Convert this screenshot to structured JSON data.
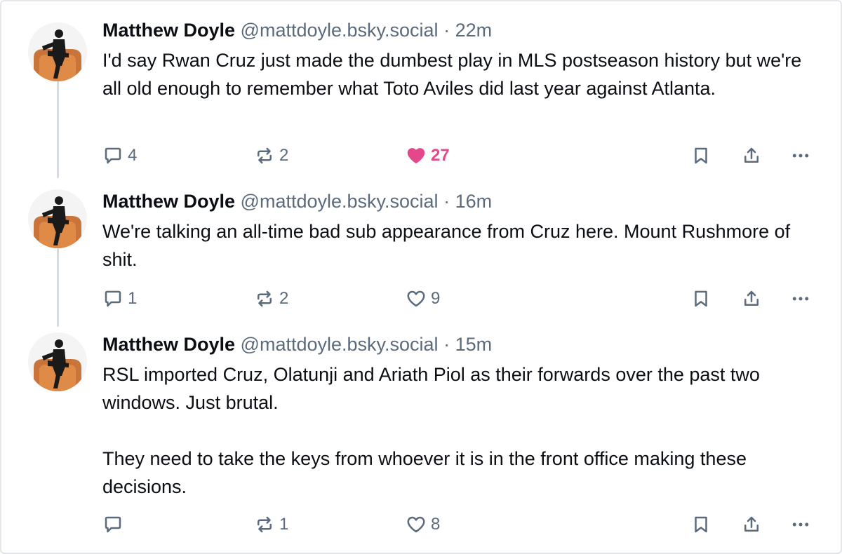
{
  "thread": {
    "posts": [
      {
        "author": {
          "name": "Matthew Doyle",
          "handle": "@mattdoyle.bsky.social"
        },
        "separator": "·",
        "time": "22m",
        "text": "I'd say Rwan Cruz just made the dumbest play in MLS postseason history but we're all old enough to remember what Toto Aviles did last year against Atlanta.",
        "replies": "4",
        "reposts": "2",
        "likes": "27",
        "liked": true
      },
      {
        "author": {
          "name": "Matthew Doyle",
          "handle": "@mattdoyle.bsky.social"
        },
        "separator": "·",
        "time": "16m",
        "text": "We're talking an all-time bad sub appearance from Cruz here. Mount Rushmore of shit.",
        "replies": "1",
        "reposts": "2",
        "likes": "9",
        "liked": false
      },
      {
        "author": {
          "name": "Matthew Doyle",
          "handle": "@mattdoyle.bsky.social"
        },
        "separator": "·",
        "time": "15m",
        "text": "RSL imported Cruz, Olatunji and Ariath Piol as their forwards over the past two windows. Just brutal.\n\nThey need to take the keys from whoever it is in the front office making these decisions.",
        "replies": "",
        "reposts": "1",
        "likes": "8",
        "liked": false
      }
    ]
  },
  "icons": {
    "reply": "speech-bubble-icon",
    "repost": "repost-arrows-icon",
    "like": "heart-icon",
    "bookmark": "bookmark-icon",
    "share": "share-upload-icon",
    "more": "more-dots-icon"
  },
  "colors": {
    "like_active": "#e5488a",
    "muted": "#5b6b7c",
    "thread_line": "#d4dbe2",
    "text": "#0b0f14"
  }
}
